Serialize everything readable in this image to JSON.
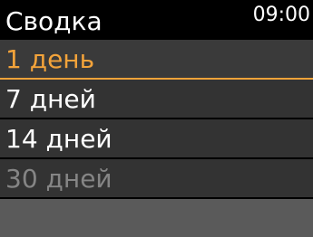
{
  "header": {
    "title": "Сводка",
    "time": "09:00"
  },
  "menu": {
    "items": [
      {
        "label": "1 день",
        "state": "selected"
      },
      {
        "label": "7 дней",
        "state": "normal"
      },
      {
        "label": "14 дней",
        "state": "normal"
      },
      {
        "label": "30 дней",
        "state": "disabled"
      }
    ]
  },
  "colors": {
    "background": "#000000",
    "row": "#333333",
    "accent": "#f3a33a",
    "text": "#ffffff",
    "disabled_text": "#858585",
    "footer": "#5a5a5a"
  }
}
